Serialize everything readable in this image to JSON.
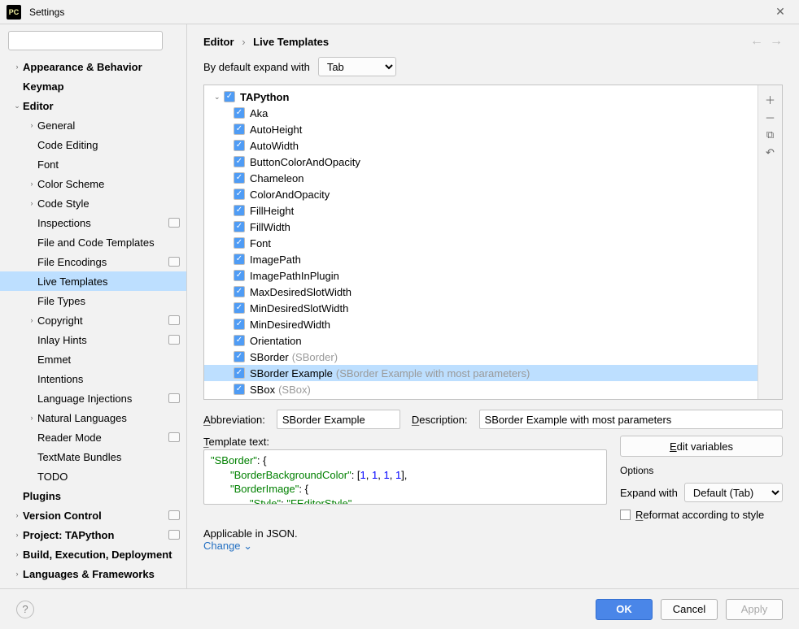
{
  "window": {
    "title": "Settings"
  },
  "search": {
    "placeholder": ""
  },
  "sidebar": {
    "items": [
      {
        "label": "Appearance & Behavior",
        "depth": 0,
        "bold": true,
        "chev": "›"
      },
      {
        "label": "Keymap",
        "depth": 0,
        "bold": true,
        "chev": ""
      },
      {
        "label": "Editor",
        "depth": 0,
        "bold": true,
        "chev": "⌄"
      },
      {
        "label": "General",
        "depth": 1,
        "bold": false,
        "chev": "›"
      },
      {
        "label": "Code Editing",
        "depth": 1,
        "bold": false,
        "chev": ""
      },
      {
        "label": "Font",
        "depth": 1,
        "bold": false,
        "chev": ""
      },
      {
        "label": "Color Scheme",
        "depth": 1,
        "bold": false,
        "chev": "›"
      },
      {
        "label": "Code Style",
        "depth": 1,
        "bold": false,
        "chev": "›"
      },
      {
        "label": "Inspections",
        "depth": 1,
        "bold": false,
        "chev": "",
        "badge": true
      },
      {
        "label": "File and Code Templates",
        "depth": 1,
        "bold": false,
        "chev": ""
      },
      {
        "label": "File Encodings",
        "depth": 1,
        "bold": false,
        "chev": "",
        "badge": true
      },
      {
        "label": "Live Templates",
        "depth": 1,
        "bold": false,
        "chev": "",
        "selected": true
      },
      {
        "label": "File Types",
        "depth": 1,
        "bold": false,
        "chev": ""
      },
      {
        "label": "Copyright",
        "depth": 1,
        "bold": false,
        "chev": "›",
        "badge": true
      },
      {
        "label": "Inlay Hints",
        "depth": 1,
        "bold": false,
        "chev": "",
        "badge": true
      },
      {
        "label": "Emmet",
        "depth": 1,
        "bold": false,
        "chev": ""
      },
      {
        "label": "Intentions",
        "depth": 1,
        "bold": false,
        "chev": ""
      },
      {
        "label": "Language Injections",
        "depth": 1,
        "bold": false,
        "chev": "",
        "badge": true
      },
      {
        "label": "Natural Languages",
        "depth": 1,
        "bold": false,
        "chev": "›"
      },
      {
        "label": "Reader Mode",
        "depth": 1,
        "bold": false,
        "chev": "",
        "badge": true
      },
      {
        "label": "TextMate Bundles",
        "depth": 1,
        "bold": false,
        "chev": ""
      },
      {
        "label": "TODO",
        "depth": 1,
        "bold": false,
        "chev": ""
      },
      {
        "label": "Plugins",
        "depth": 0,
        "bold": true,
        "chev": ""
      },
      {
        "label": "Version Control",
        "depth": 0,
        "bold": true,
        "chev": "›",
        "badge": true
      },
      {
        "label": "Project: TAPython",
        "depth": 0,
        "bold": true,
        "chev": "›",
        "badge": true
      },
      {
        "label": "Build, Execution, Deployment",
        "depth": 0,
        "bold": true,
        "chev": "›"
      },
      {
        "label": "Languages & Frameworks",
        "depth": 0,
        "bold": true,
        "chev": "›"
      }
    ]
  },
  "breadcrumb": {
    "a": "Editor",
    "b": "Live Templates"
  },
  "expand": {
    "label": "By default expand with",
    "value": "Tab"
  },
  "templates": {
    "group": "TAPython",
    "items": [
      {
        "name": "Aka"
      },
      {
        "name": "AutoHeight"
      },
      {
        "name": "AutoWidth"
      },
      {
        "name": "ButtonColorAndOpacity"
      },
      {
        "name": "Chameleon"
      },
      {
        "name": "ColorAndOpacity"
      },
      {
        "name": "FillHeight"
      },
      {
        "name": "FillWidth"
      },
      {
        "name": "Font"
      },
      {
        "name": "ImagePath"
      },
      {
        "name": "ImagePathInPlugin"
      },
      {
        "name": "MaxDesiredSlotWidth"
      },
      {
        "name": "MinDesiredSlotWidth"
      },
      {
        "name": "MinDesiredWidth"
      },
      {
        "name": "Orientation"
      },
      {
        "name": "SBorder",
        "hint": "(SBorder)"
      },
      {
        "name": "SBorder Example",
        "hint": "(SBorder Example with most parameters)",
        "selected": true
      },
      {
        "name": "SBox",
        "hint": "(SBox)"
      }
    ]
  },
  "detail": {
    "abbr_label": "Abbreviation:",
    "abbr_value": "SBorder Example",
    "desc_label": "Description:",
    "desc_value": "SBorder Example with most parameters",
    "template_text_label": "Template text:",
    "code_l1a": "\"SBorder\"",
    "code_l1b": ": {",
    "code_l2a": "\"BorderBackgroundColor\"",
    "code_l2b": ": [",
    "code_l2c": "1",
    "code_l2d": "],",
    "code_l3a": "\"BorderImage\"",
    "code_l3b": ": {",
    "code_l4a": "\"Style\"",
    "code_l4b": ": ",
    "code_l4c": "\"FEditorStyle\"",
    "code_l4d": ",",
    "edit_vars": "Edit variables",
    "options_label": "Options",
    "expand_with_label": "Expand with",
    "expand_with_value": "Default (Tab)",
    "reformat_label": "Reformat according to style",
    "applicable": "Applicable in JSON.",
    "change": "Change"
  },
  "footer": {
    "ok": "OK",
    "cancel": "Cancel",
    "apply": "Apply"
  }
}
